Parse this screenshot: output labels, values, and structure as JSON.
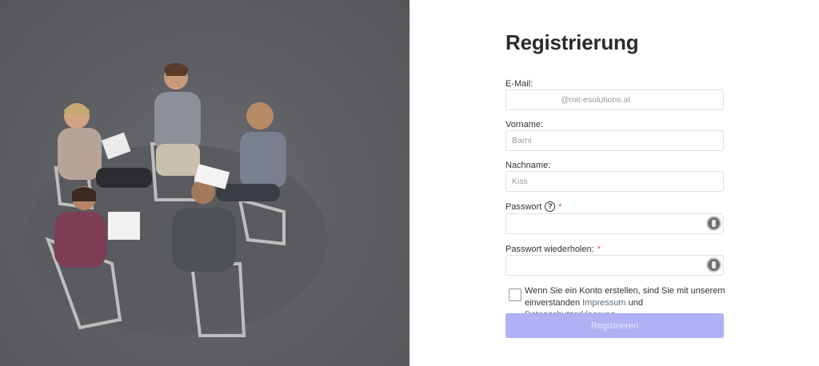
{
  "page": {
    "title": "Registrierung"
  },
  "form": {
    "email": {
      "label": "E-Mail:",
      "value": "@mit-esolutions.at"
    },
    "firstname": {
      "label": "Vorname:",
      "value": "Barni"
    },
    "lastname": {
      "label": "Nachname:",
      "value": "Kiss"
    },
    "password": {
      "label": "Passwort",
      "required_mark": "*",
      "value": ""
    },
    "password_repeat": {
      "label": "Passwort wiederholen:",
      "required_mark": "*",
      "value": ""
    },
    "terms": {
      "text_before": "Wenn Sie ein Konto erstellen, sind Sie mit unserem einverstanden",
      "link_impressum": "Impressum",
      "text_and": "und",
      "link_privacy": "Datenschutzerklaerung"
    },
    "submit_label": "Registrieren"
  },
  "colors": {
    "submit_bg": "#b0b0f5",
    "required": "#d9534f",
    "photo_overlay": "#5f6064"
  },
  "icons": {
    "help": "question-circle-icon",
    "password_manager": "password-manager-icon"
  }
}
